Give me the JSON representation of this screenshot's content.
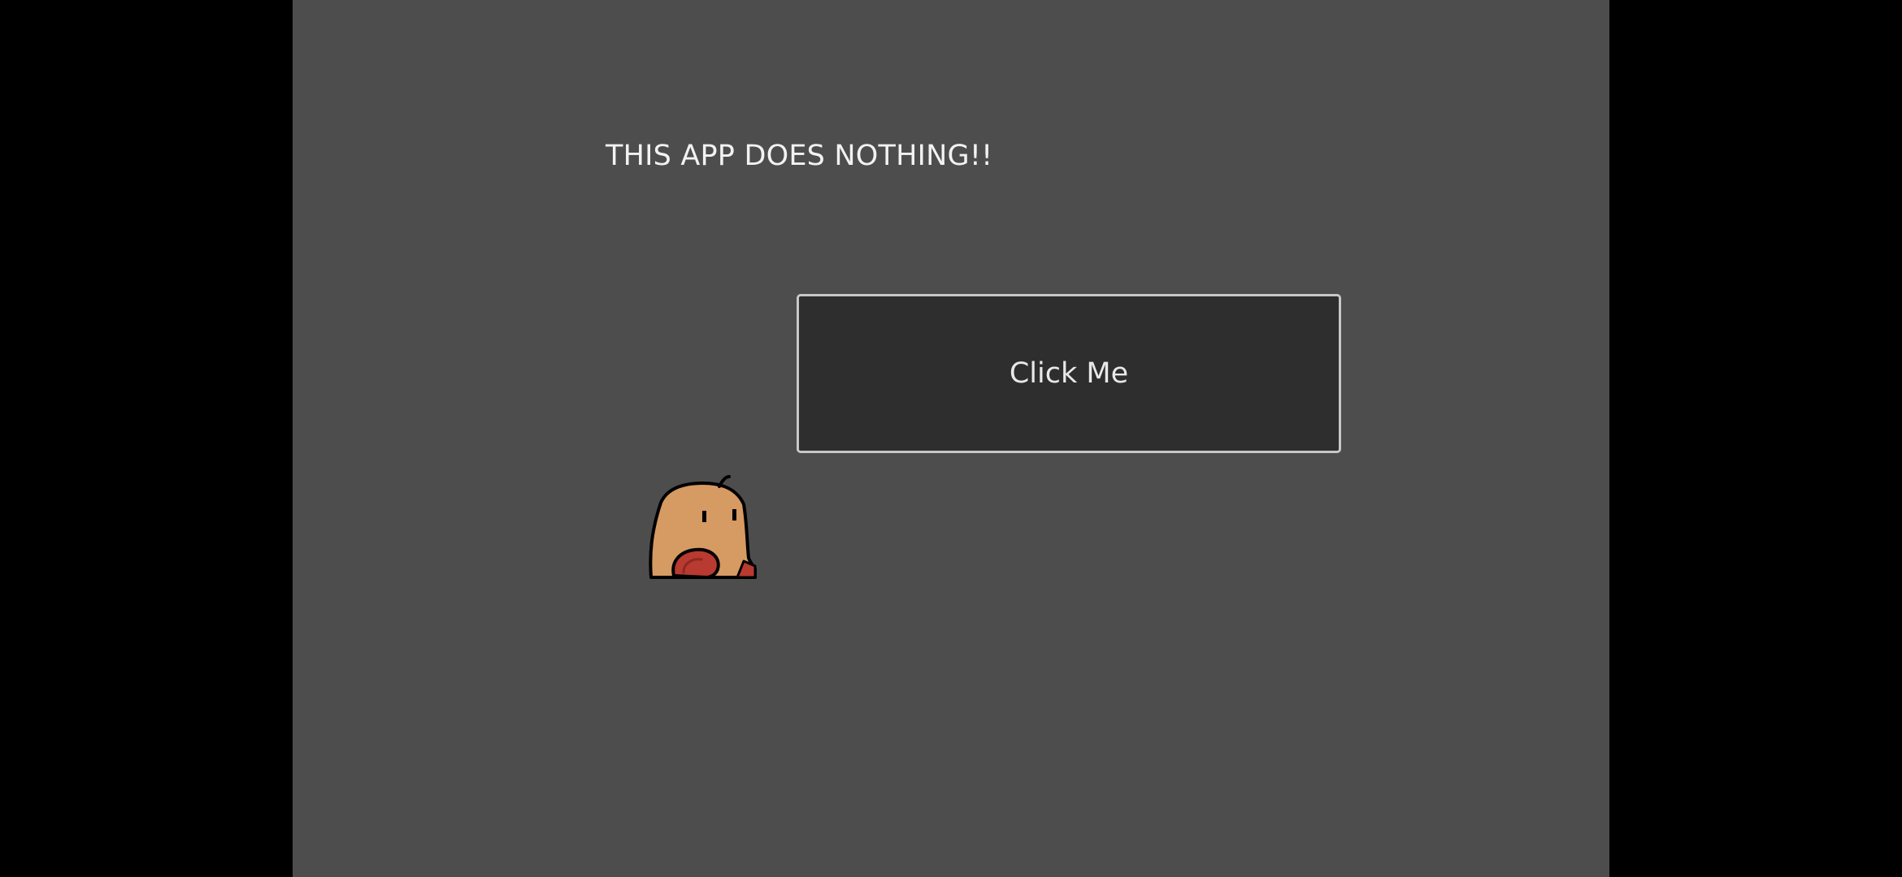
{
  "app": {
    "title_text": "THIS APP DOES NOTHING!!",
    "button_label": "Click Me"
  },
  "colors": {
    "background": "#4d4d4d",
    "letterbox": "#000000",
    "button_fill": "#2e2e2e",
    "button_border": "#c8c8c8",
    "text": "#f2f2f2"
  },
  "icons": {
    "mascot": "screaming-blob-character-icon"
  }
}
